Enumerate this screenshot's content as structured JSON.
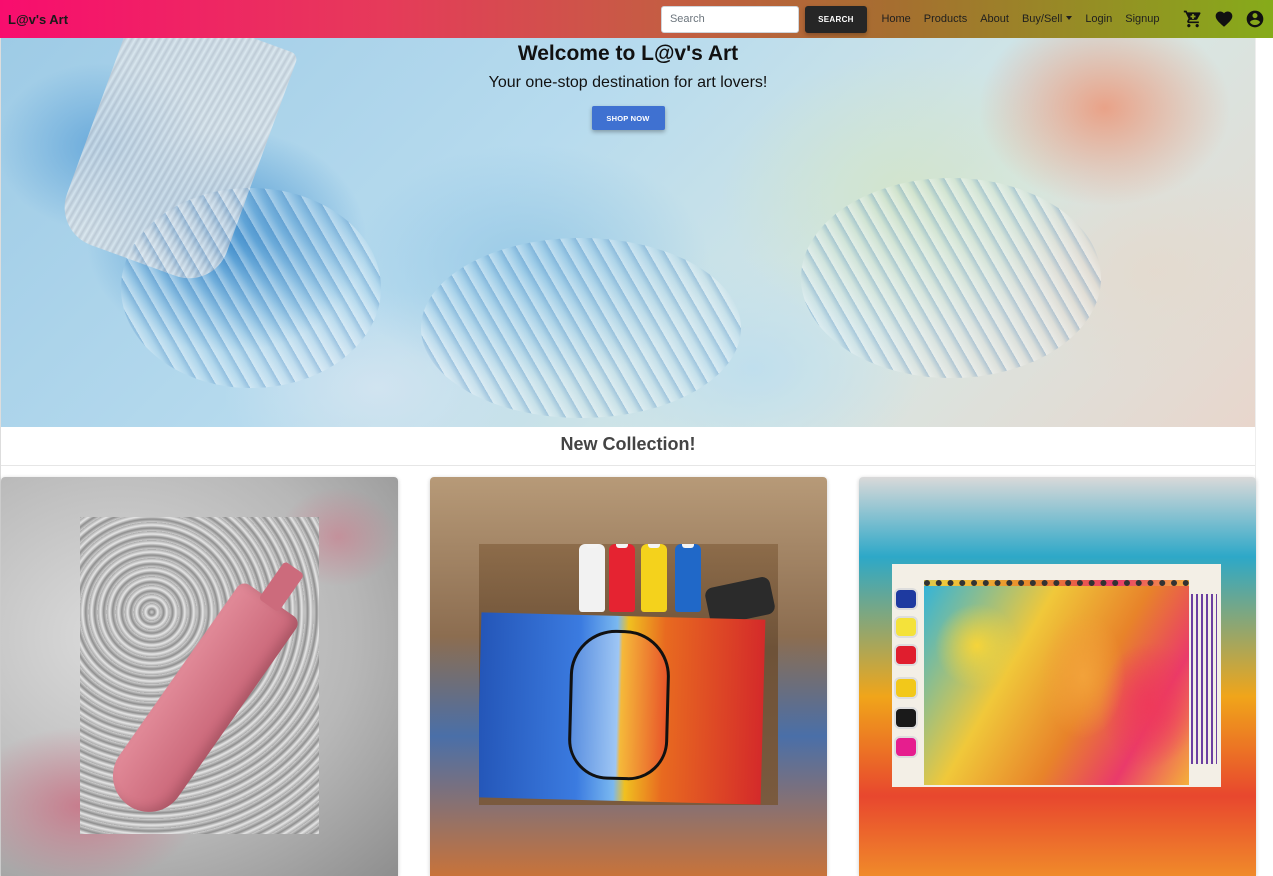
{
  "navbar": {
    "brand": "L@v's Art",
    "search_placeholder": "Search",
    "search_button": "SEARCH",
    "links": {
      "home": "Home",
      "products": "Products",
      "about": "About",
      "buy_sell": "Buy/Sell",
      "login": "Login",
      "signup": "Signup"
    },
    "icons": [
      "cart-icon",
      "heart-icon",
      "account-icon"
    ]
  },
  "hero": {
    "title": "Welcome to L@v's Art",
    "subtitle": "Your one-stop destination for art lovers!",
    "button": "SHOP NOW"
  },
  "collection": {
    "title": "New Collection!"
  },
  "colors": {
    "navbar_gradient_start": "#f80d6e",
    "navbar_gradient_end": "#86ab1a",
    "search_button_bg": "#262626",
    "shop_button_bg": "#3f71d1"
  }
}
